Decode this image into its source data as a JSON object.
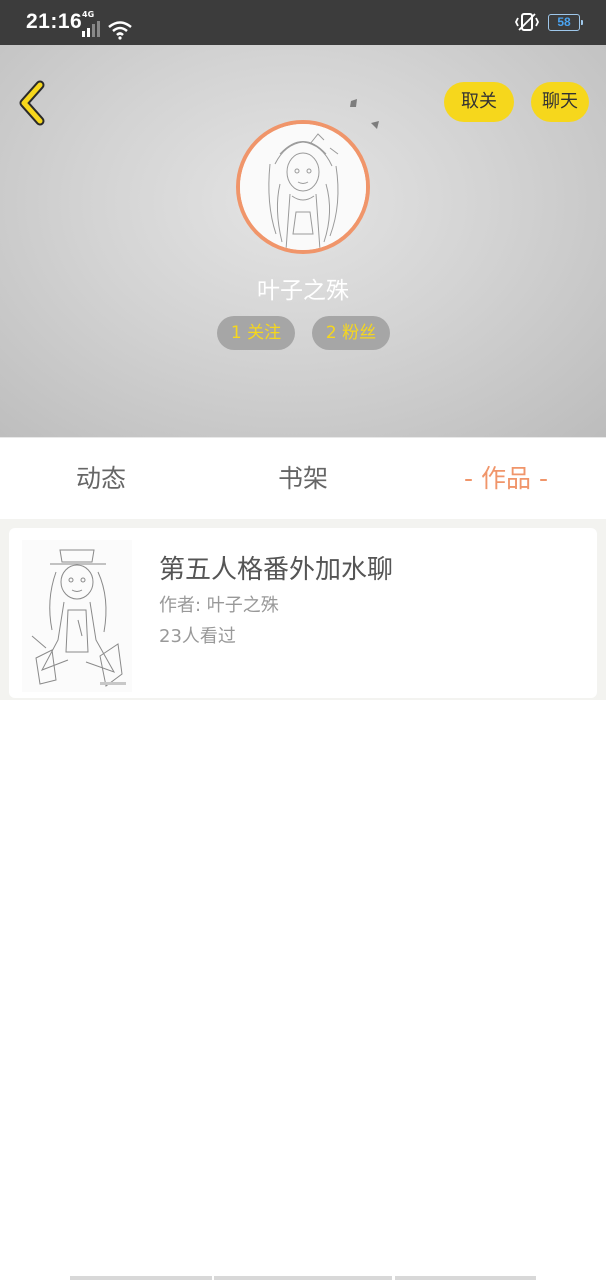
{
  "status_bar": {
    "time": "21:16",
    "network": "4G",
    "battery": "58"
  },
  "header": {
    "back_icon": "chevron-left-icon",
    "unfollow_label": "取关",
    "chat_label": "聊天",
    "username": "叶子之殊",
    "stats": {
      "following": "1 关注",
      "fans": "2 粉丝"
    }
  },
  "tabs": [
    {
      "label": "动态"
    },
    {
      "label": "书架"
    },
    {
      "label": "- 作品 -"
    }
  ],
  "works": [
    {
      "title": "第五人格番外加水聊",
      "author": "作者: 叶子之殊",
      "views": "23人看过"
    }
  ],
  "colors": {
    "accent_yellow": "#f6d71c",
    "accent_orange": "#f0956a",
    "status_bar": "#3c3c3c"
  }
}
